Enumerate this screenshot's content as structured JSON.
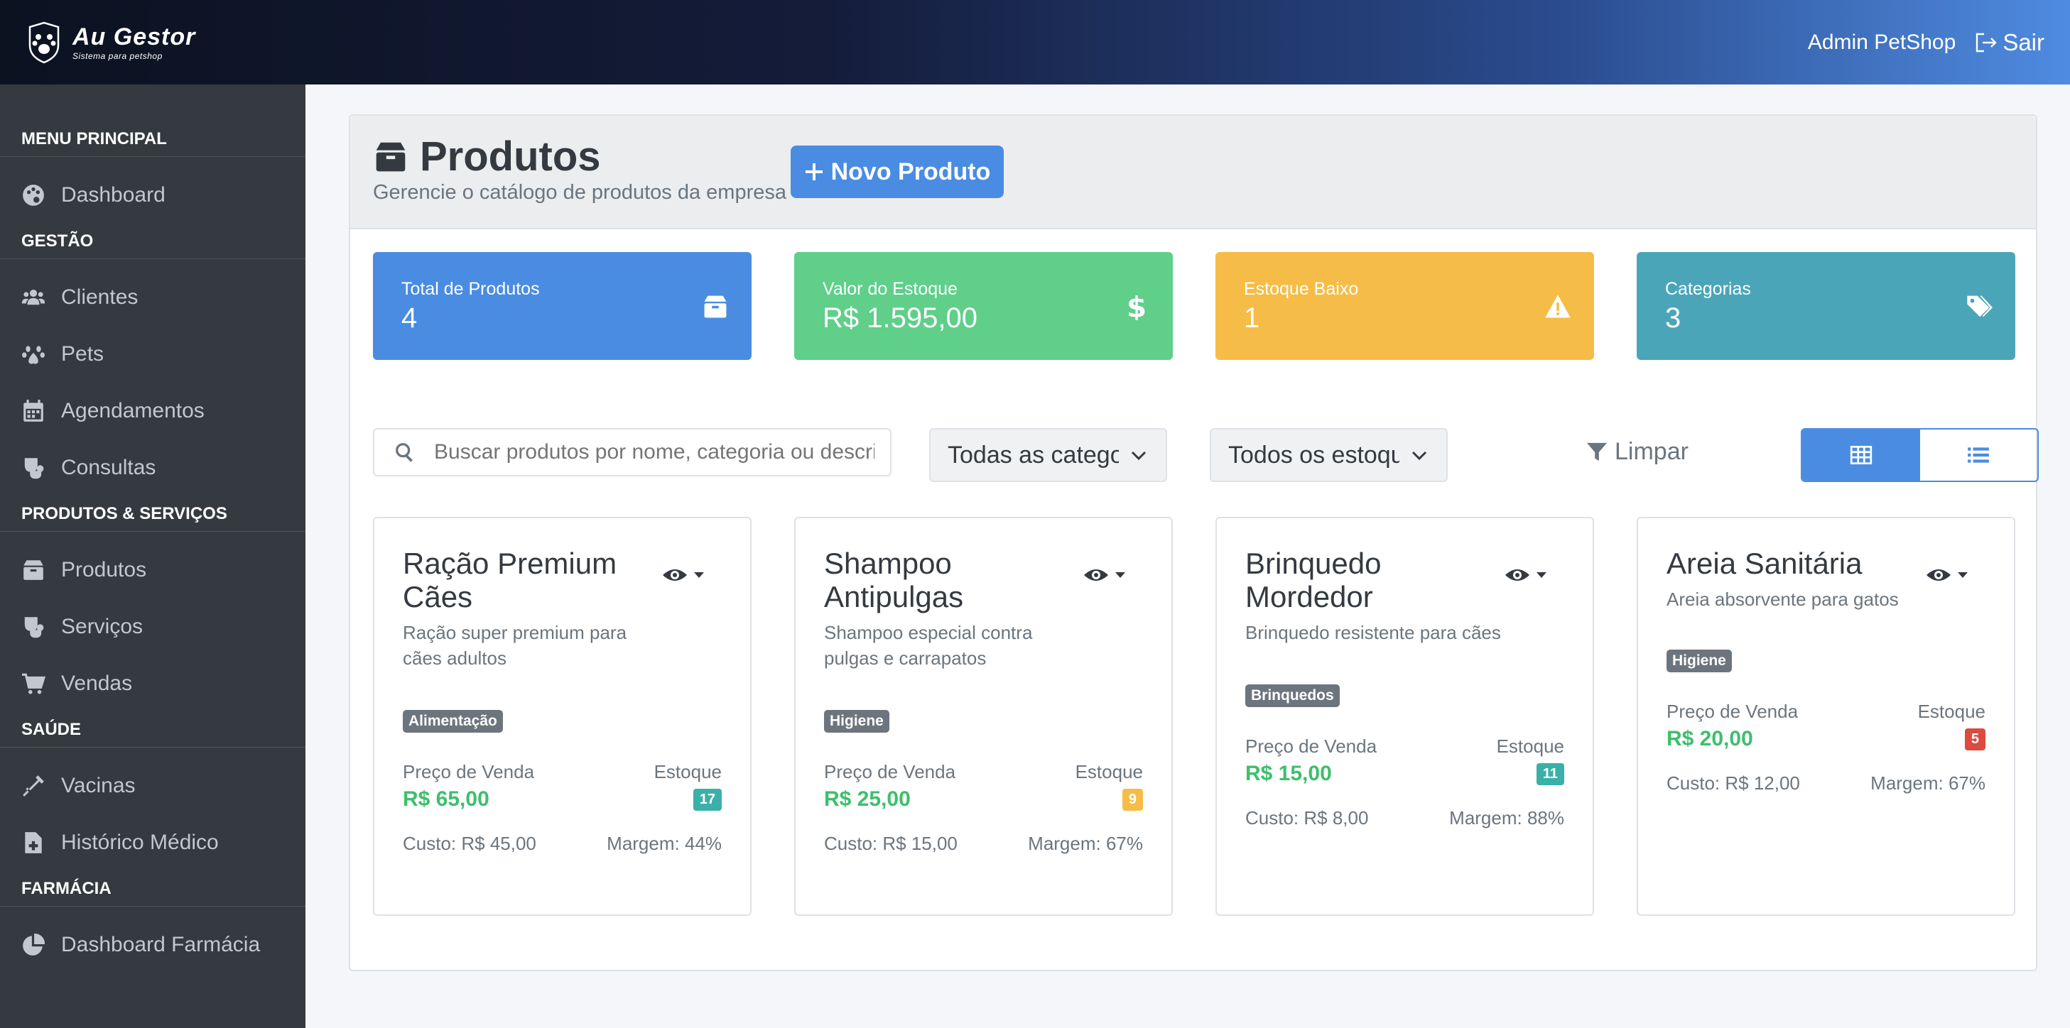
{
  "brand": {
    "title": "Au Gestor",
    "subtitle": "Sistema para petshop"
  },
  "user": {
    "name": "Admin PetShop",
    "logout_label": "Sair"
  },
  "sidebar": {
    "sections": [
      {
        "title": "MENU PRINCIPAL",
        "items": [
          {
            "label": "Dashboard",
            "icon": "palette-icon"
          }
        ]
      },
      {
        "title": "GESTÃO",
        "items": [
          {
            "label": "Clientes",
            "icon": "users-icon"
          },
          {
            "label": "Pets",
            "icon": "paw-icon"
          },
          {
            "label": "Agendamentos",
            "icon": "calendar-icon"
          },
          {
            "label": "Consultas",
            "icon": "stethoscope-icon"
          }
        ]
      },
      {
        "title": "PRODUTOS & SERVIÇOS",
        "items": [
          {
            "label": "Produtos",
            "icon": "box-icon"
          },
          {
            "label": "Serviços",
            "icon": "stethoscope-icon"
          },
          {
            "label": "Vendas",
            "icon": "cart-icon"
          }
        ]
      },
      {
        "title": "SAÚDE",
        "items": [
          {
            "label": "Vacinas",
            "icon": "syringe-icon"
          },
          {
            "label": "Histórico Médico",
            "icon": "file-medical-icon"
          }
        ]
      },
      {
        "title": "FARMÁCIA",
        "items": [
          {
            "label": "Dashboard Farmácia",
            "icon": "pie-chart-icon"
          }
        ]
      }
    ]
  },
  "page": {
    "title": "Produtos",
    "subtitle": "Gerencie o catálogo de produtos da empresa",
    "new_button": "Novo Produto"
  },
  "stats": [
    {
      "label": "Total de Produtos",
      "value": "4",
      "color": "#4a8ce2",
      "icon": "box-icon"
    },
    {
      "label": "Valor do Estoque",
      "value": "R$ 1.595,00",
      "color": "#5fcf8a",
      "icon": "dollar-icon"
    },
    {
      "label": "Estoque Baixo",
      "value": "1",
      "color": "#f5bd47",
      "icon": "warning-icon"
    },
    {
      "label": "Categorias",
      "value": "3",
      "color": "#4ba5b9",
      "icon": "tags-icon"
    }
  ],
  "filters": {
    "search_placeholder": "Buscar produtos por nome, categoria ou descrição...",
    "category_select": "Todas as categorias",
    "stock_select": "Todos os estoques",
    "clear_label": "Limpar"
  },
  "products": [
    {
      "name": "Ração Premium Cães",
      "description": "Ração super premium para cães adultos",
      "category": "Alimentação",
      "price_label": "Preço de Venda",
      "price": "R$ 65,00",
      "stock_label": "Estoque",
      "stock": "17",
      "stock_color": "#3ab0a8",
      "cost": "Custo: R$ 45,00",
      "margin": "Margem: 44%"
    },
    {
      "name": "Shampoo Antipulgas",
      "description": "Shampoo especial contra pulgas e carrapatos",
      "category": "Higiene",
      "price_label": "Preço de Venda",
      "price": "R$ 25,00",
      "stock_label": "Estoque",
      "stock": "9",
      "stock_color": "#f5bd47",
      "cost": "Custo: R$ 15,00",
      "margin": "Margem: 67%"
    },
    {
      "name": "Brinquedo Mordedor",
      "description": "Brinquedo resistente para cães",
      "category": "Brinquedos",
      "price_label": "Preço de Venda",
      "price": "R$ 15,00",
      "stock_label": "Estoque",
      "stock": "11",
      "stock_color": "#3ab0a8",
      "cost": "Custo: R$ 8,00",
      "margin": "Margem: 88%"
    },
    {
      "name": "Areia Sanitária",
      "description": "Areia absorvente para gatos",
      "category": "Higiene",
      "price_label": "Preço de Venda",
      "price": "R$ 20,00",
      "stock_label": "Estoque",
      "stock": "5",
      "stock_color": "#dc4a40",
      "cost": "Custo: R$ 12,00",
      "margin": "Margem: 67%"
    }
  ]
}
